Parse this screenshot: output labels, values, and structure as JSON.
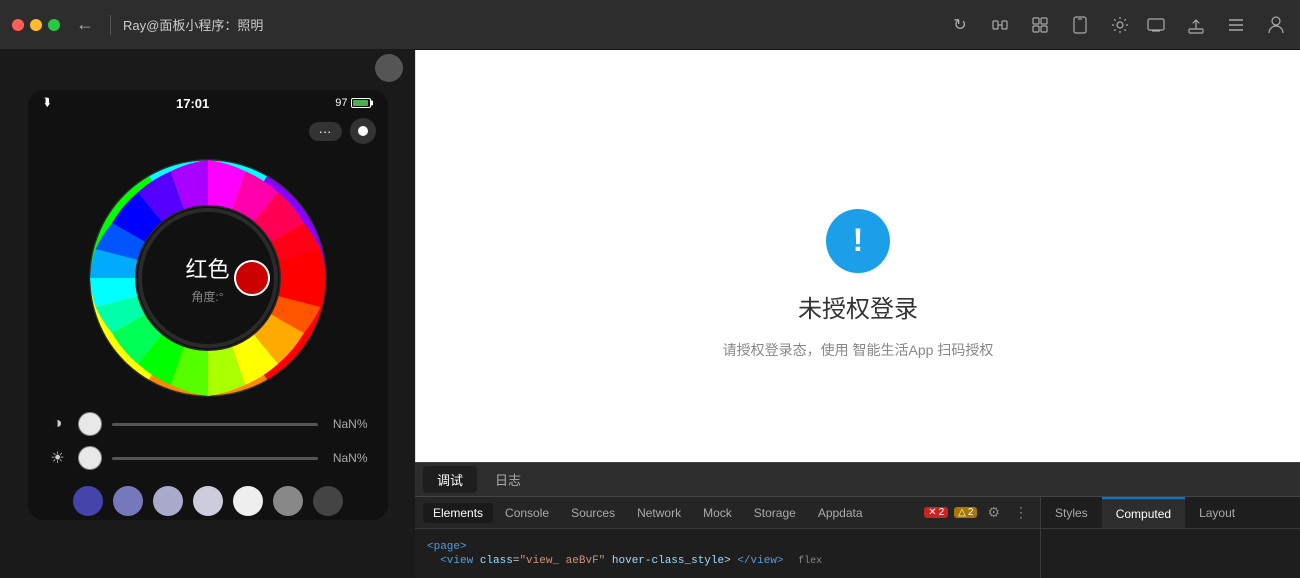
{
  "titleBar": {
    "title": "Ray@面板小程序：照明",
    "backLabel": "←"
  },
  "toolbar": {
    "icons": [
      "↺",
      "⊞",
      "⚙",
      "☐",
      "⚙"
    ]
  },
  "rightToolbar": {
    "icons": [
      "⊟",
      "↑",
      "≡",
      "👤"
    ]
  },
  "phone": {
    "time": "17:01",
    "battery": "97",
    "colorWheelLabel": "红色",
    "angleLabel": "角度:°",
    "slider1Value": "NaN%",
    "slider2Value": "NaN%",
    "controls": "···"
  },
  "preview": {
    "title": "未授权登录",
    "subtitle": "请授权登录态，使用 智能生活App 扫码授权",
    "alertSymbol": "!"
  },
  "devtools": {
    "tabs": [
      "调试",
      "日志"
    ],
    "activeTab": "调试",
    "subtabs": [
      "Elements",
      "Console",
      "Sources",
      "Network",
      "Mock",
      "Storage",
      "Appdata"
    ],
    "activeSubtab": "Elements",
    "stylesTabs": [
      "Styles",
      "Computed",
      "Layout"
    ],
    "activeStylesTab": "Computed",
    "errorCount": "2",
    "warnCount": "2",
    "codeLine1": "<page>",
    "codeLine2": "  <view class=\"view_ aeBvF\" hover-class_style> </view> flex"
  }
}
